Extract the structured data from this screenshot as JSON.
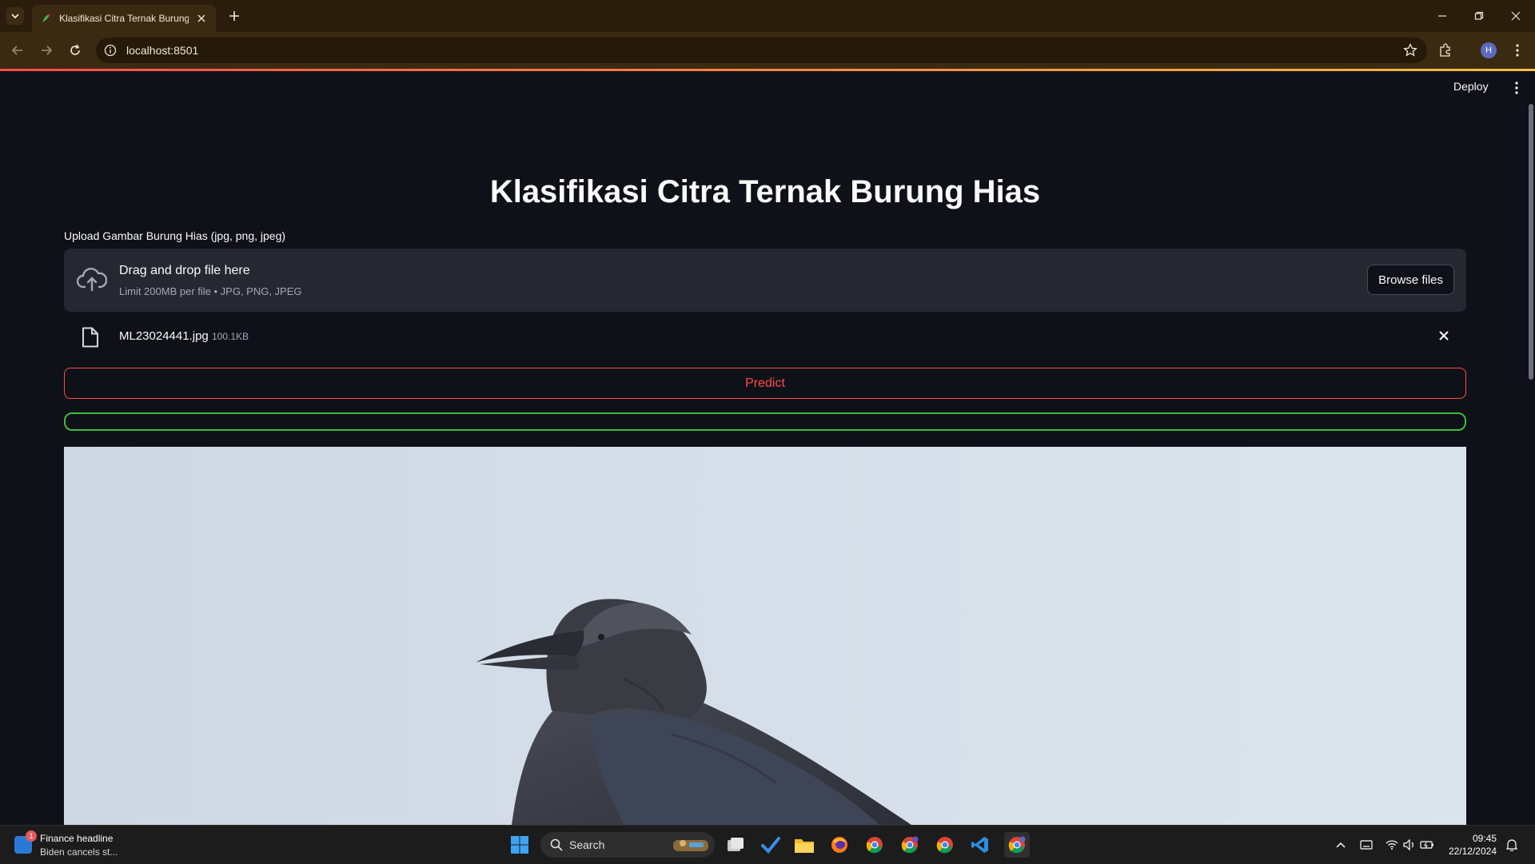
{
  "browser": {
    "tab_title": "Klasifikasi Citra Ternak Burung Hias",
    "url": "localhost:8501",
    "profile_initial": "H"
  },
  "app": {
    "deploy_label": "Deploy",
    "title": "Klasifikasi Citra Ternak Burung Hias",
    "uploader": {
      "label": "Upload Gambar Burung Hias (jpg, png, jpeg)",
      "drop_title": "Drag and drop file here",
      "limit_text": "Limit 200MB per file • JPG, PNG, JPEG",
      "browse_label": "Browse files"
    },
    "file": {
      "name": "ML23024441.jpg",
      "size": "100.1KB"
    },
    "predict_label": "Predict"
  },
  "taskbar": {
    "widget_title": "Finance headline",
    "widget_subtitle": "Biden cancels st...",
    "widget_badge": "1",
    "search_placeholder": "Search",
    "time": "09:45",
    "date": "22/12/2024"
  },
  "colors": {
    "accent": "#ff4b4b",
    "success": "#3dbd3d",
    "app_bg": "#0e1117"
  }
}
